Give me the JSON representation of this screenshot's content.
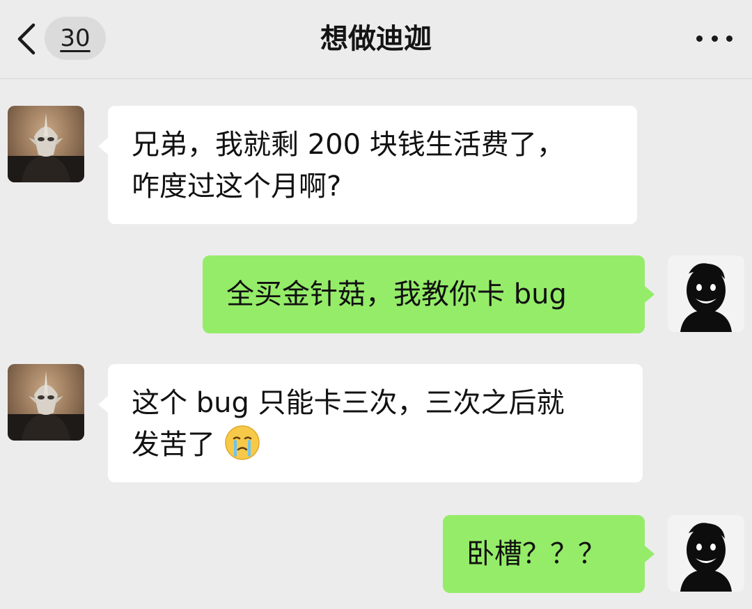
{
  "header": {
    "back_icon": "chevron-left-icon",
    "unread_count": "30",
    "title": "想做迪迦",
    "more_icon": "more-dots-icon"
  },
  "messages": [
    {
      "side": "left",
      "lines": [
        "兄弟，我就剩 200 块钱生活费了，",
        "咋度过这个月啊?"
      ]
    },
    {
      "side": "right",
      "lines": [
        "全买金针菇，我教你卡 bug"
      ]
    },
    {
      "side": "left",
      "lines": [
        "这个 bug 只能卡三次，三次之后就",
        "发苦了"
      ],
      "emoji": "crying-face-emoji"
    },
    {
      "side": "right",
      "lines": [
        "卧槽？？？"
      ]
    }
  ],
  "colors": {
    "background": "#edeced",
    "incoming_bubble": "#ffffff",
    "outgoing_bubble": "#95ec69"
  }
}
